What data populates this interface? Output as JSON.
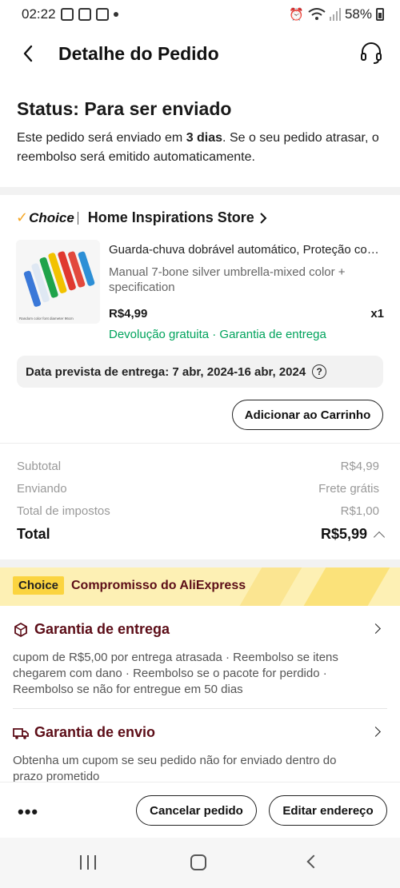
{
  "status_bar": {
    "time": "02:22",
    "battery": "58%"
  },
  "header": {
    "title": "Detalhe do Pedido"
  },
  "order_status": {
    "title": "Status: Para ser enviado",
    "desc_before": "Este pedido será enviado em ",
    "desc_bold": "3 dias",
    "desc_after": ". Se o seu pedido atrasar, o reembolso será emitido automaticamente."
  },
  "store": {
    "choice_label": "Choice",
    "name": "Home Inspirations Store"
  },
  "product": {
    "title": "Guarda-chuva dobrável automático, Proteção contra raios UV",
    "spec": "Manual 7-bone silver umbrella-mixed color + specification",
    "price": "R$4,99",
    "qty": "x1",
    "guarantees": "Devolução gratuita · Garantia de entrega",
    "thumb_caption": "Random color font diameter 96cm"
  },
  "delivery": {
    "text": "Data prevista de entrega: 7 abr, 2024-16 abr, 2024"
  },
  "add_to_cart_label": "Adicionar ao Carrinho",
  "summary": {
    "subtotal_label": "Subtotal",
    "subtotal_value": "R$4,99",
    "shipping_label": "Enviando",
    "shipping_value": "Frete grátis",
    "tax_label": "Total de impostos",
    "tax_value": "R$1,00",
    "total_label": "Total",
    "total_value": "R$5,99"
  },
  "commitment": {
    "badge": "Choice",
    "text": "Compromisso do AliExpress"
  },
  "delivery_guarantee": {
    "title": "Garantia de entrega",
    "desc": "cupom de R$5,00 por entrega atrasada · Reembolso se itens chegarem com dano · Reembolso se o pacote for perdido · Reembolso se não for entregue em 50 dias"
  },
  "shipping_guarantee": {
    "title": "Garantia de envio",
    "desc": "Obtenha um cupom se seu pedido não for enviado dentro do prazo prometido"
  },
  "bottom": {
    "more": "•••",
    "cancel_label": "Cancelar pedido",
    "edit_label": "Editar endereço"
  },
  "colors": {
    "accent_green": "#00a35c",
    "maroon": "#5c0d17",
    "choice_yellow": "#fbd43f"
  }
}
